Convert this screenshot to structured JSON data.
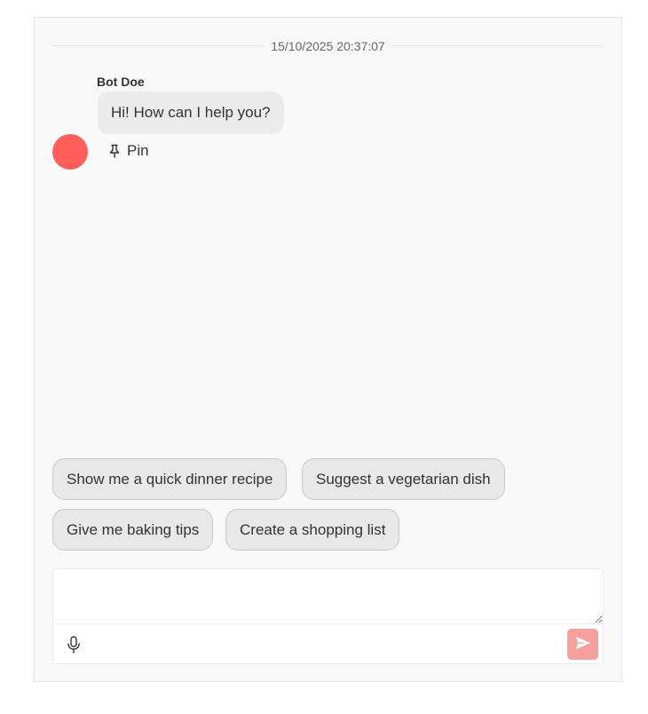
{
  "chat": {
    "timestamp": "15/10/2025 20:37:07",
    "message": {
      "sender": "Bot Doe",
      "text": "Hi! How can I help you?",
      "avatar_color": "#ff5f5a"
    },
    "pin_label": "Pin"
  },
  "suggestions": [
    "Show me a quick dinner recipe",
    "Suggest a vegetarian dish",
    "Give me baking tips",
    "Create a shopping list"
  ],
  "composer": {
    "placeholder": "",
    "mic_icon": "microphone-icon",
    "send_icon": "send-icon",
    "send_color": "#f5a09c"
  }
}
